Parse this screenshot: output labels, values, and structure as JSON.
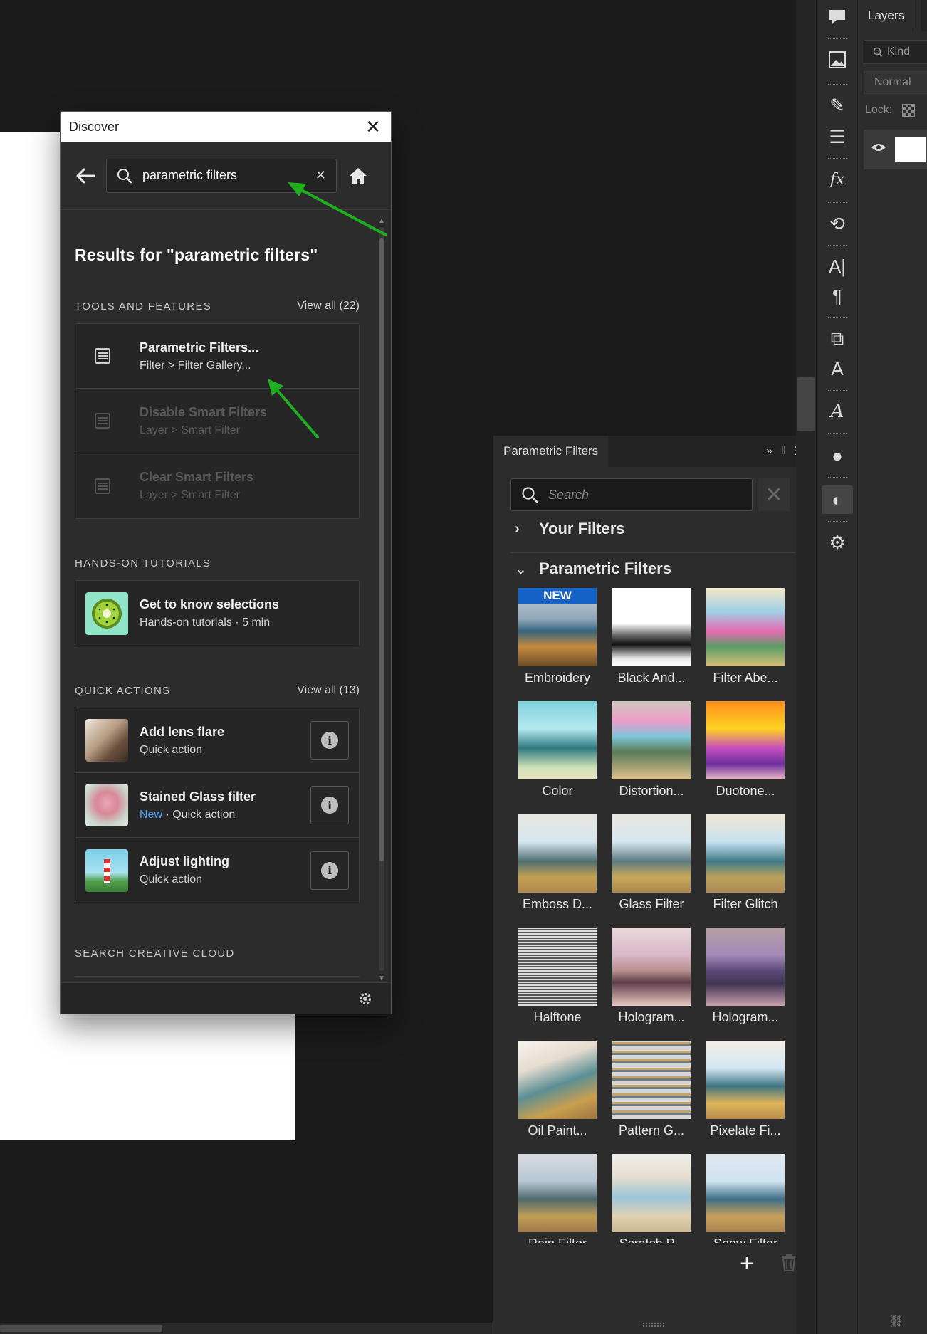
{
  "discover": {
    "title": "Discover",
    "search_value": "parametric filters",
    "results_heading": "Results for \"parametric filters\"",
    "tools": {
      "heading": "TOOLS AND FEATURES",
      "view_all": "View all (22)",
      "items": [
        {
          "title": "Parametric Filters...",
          "path": "Filter > Filter Gallery..."
        },
        {
          "title": "Disable Smart Filters",
          "path": "Layer > Smart Filter"
        },
        {
          "title": "Clear Smart Filters",
          "path": "Layer > Smart Filter"
        }
      ]
    },
    "tutorials": {
      "heading": "HANDS-ON TUTORIALS",
      "items": [
        {
          "title": "Get to know selections",
          "meta": "Hands-on tutorials  ·  5 min"
        }
      ]
    },
    "quick_actions": {
      "heading": "QUICK ACTIONS",
      "view_all": "View all (13)",
      "items": [
        {
          "title": "Add lens flare",
          "meta": "Quick action"
        },
        {
          "title": "Stained Glass filter",
          "new_tag": "New",
          "meta": "Quick action"
        },
        {
          "title": "Adjust lighting",
          "meta": "Quick action"
        }
      ]
    },
    "search_cc_heading": "SEARCH CREATIVE CLOUD"
  },
  "parametric_panel": {
    "tab_label": "Parametric Filters",
    "search_placeholder": "Search",
    "group_your_filters": "Your Filters",
    "group_parametric": "Parametric Filters",
    "new_badge": "NEW",
    "tiles": [
      "Embroidery",
      "Black And...",
      "Filter Abe...",
      "Color",
      "Distortion...",
      "Duotone...",
      "Emboss D...",
      "Glass Filter",
      "Filter Glitch",
      "Halftone",
      "Hologram...",
      "Hologram...",
      "Oil Paint...",
      "Pattern G...",
      "Pixelate Fi...",
      "Rain Filter",
      "Scratch P...",
      "Snow Filter"
    ]
  },
  "layers_panel": {
    "tab_label": "Layers",
    "kind_label": "Kind",
    "blend_mode": "Normal",
    "lock_label": "Lock:"
  },
  "colors": {
    "accent_arrow": "#1fae1f",
    "new_badge": "#1462c8",
    "new_tag_text": "#4aa3ff"
  }
}
